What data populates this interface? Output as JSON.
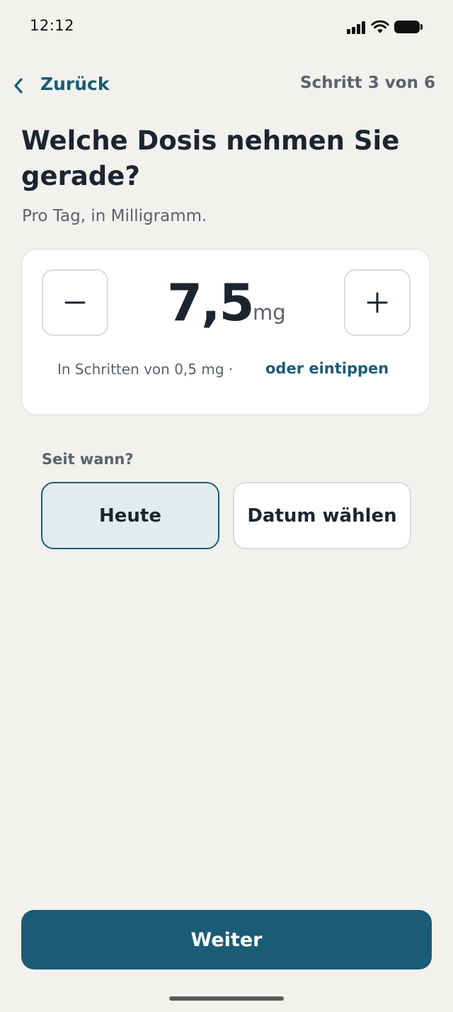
{
  "status_bar": {
    "time": "12:12",
    "icons": [
      "signal-icon",
      "wifi-icon",
      "battery-icon"
    ]
  },
  "header": {
    "back_label": "Zurück",
    "step_label": "Schritt 3 von 6"
  },
  "question": {
    "title": "Welche Dosis nehmen Sie gerade?",
    "subtitle": "Pro Tag, in Milligramm."
  },
  "dose": {
    "value": "7,5",
    "unit": "mg",
    "decrement_icon": "minus-icon",
    "increment_icon": "plus-icon",
    "hint": "In Schritten von 0,5 mg ·",
    "type_link": "oder eintippen"
  },
  "since": {
    "label": "Seit wann?",
    "options": [
      {
        "label": "Heute",
        "selected": true
      },
      {
        "label": "Datum wählen",
        "selected": false
      }
    ]
  },
  "footer": {
    "next_label": "Weiter"
  },
  "colors": {
    "background": "#f2f1ee",
    "accent": "#1a5c75",
    "text": "#1c2430",
    "muted": "#5b626b",
    "selected_fill": "#e2ecef"
  }
}
